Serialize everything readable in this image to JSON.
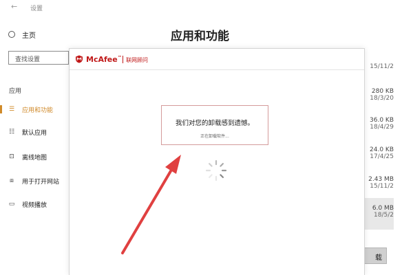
{
  "settings_window": {
    "title": "设置",
    "home_label": "主页",
    "search_placeholder": "查找设置",
    "section_label": "应用",
    "nav_items": [
      {
        "label": "应用和功能",
        "icon": "apps-list-icon"
      },
      {
        "label": "默认应用",
        "icon": "default-apps-icon"
      },
      {
        "label": "离线地图",
        "icon": "offline-maps-icon"
      },
      {
        "label": "用于打开网站",
        "icon": "web-app-icon"
      },
      {
        "label": "视频播放",
        "icon": "video-icon"
      }
    ],
    "page_title": "应用和功能",
    "list_rows": [
      {
        "size": "",
        "date": "15/11/2"
      },
      {
        "size": "280 KB",
        "date": "18/3/20"
      },
      {
        "size": "36.0 KB",
        "date": "18/4/29"
      },
      {
        "size": "24.0 KB",
        "date": "17/4/25"
      },
      {
        "size": "2.43 MB",
        "date": "15/11/2"
      },
      {
        "size": "6.0 MB",
        "date": "18/5/2"
      }
    ],
    "uninstall_label": "载"
  },
  "dialog": {
    "brand": "McAfee",
    "trademark": "™",
    "subbrand": "联网顾问",
    "message": "我们对您的卸载感到遗憾。",
    "status": "正在卸载软件...",
    "brand_color": "#c01818"
  },
  "annotation": {
    "color": "#e04040"
  }
}
